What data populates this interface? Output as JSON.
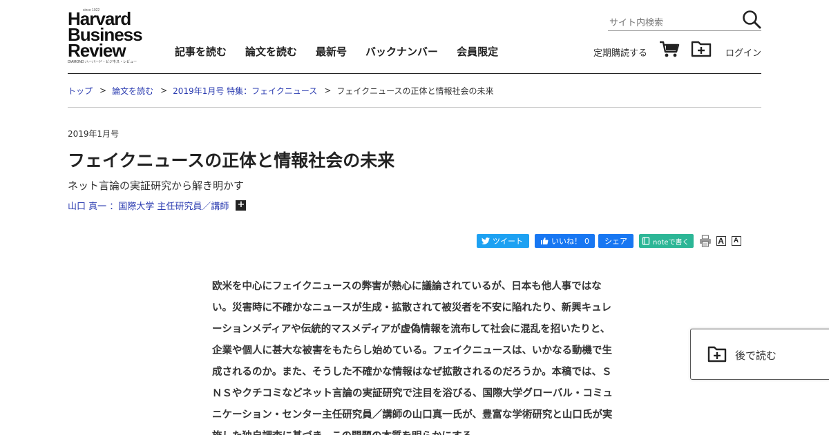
{
  "header": {
    "logo": {
      "tagline": "since 1922",
      "line1": "Harvard",
      "line2": "Business",
      "line3": "Review",
      "sub": "DIAMOND ハーバード・ビジネス・レビュー"
    },
    "nav": [
      {
        "label": "記事を読む"
      },
      {
        "label": "論文を読む"
      },
      {
        "label": "最新号"
      },
      {
        "label": "バックナンバー"
      },
      {
        "label": "会員限定"
      }
    ],
    "search": {
      "placeholder": "サイト内検索",
      "icon": "search-icon"
    },
    "subscribe_label": "定期購読する",
    "cart_icon": "cart-icon",
    "read_later_icon": "folder-plus-icon",
    "login_label": "ログイン"
  },
  "breadcrumb": {
    "items": [
      {
        "label": "トップ"
      },
      {
        "label": "論文を読む"
      },
      {
        "label": "2019年1月号 特集：フェイクニュース"
      }
    ],
    "separator": ">",
    "current": "フェイクニュースの正体と情報社会の未来"
  },
  "article": {
    "issue": "2019年1月号",
    "title": "フェイクニュースの正体と情報社会の未来",
    "subtitle": "ネット言論の実証研究から解き明かす",
    "author": "山口 真一 ：国際大学 主任研究員／講師",
    "author_more": "+",
    "lead": "欧米を中心にフェイクニュースの弊害が熱心に議論されているが、日本も他人事ではない。災害時に不確かなニュースが生成・拡散されて被災者を不安に陥れたり、新興キュレーションメディアや伝統的マスメディアが虚偽情報を流布して社会に混乱を招いたりと、企業や個人に甚大な被害をもたらし始めている。フェイクニュースは、いかなる動機で生成されるのか。また、そうした不確かな情報はなぜ拡散されるのだろうか。本稿では、ＳＮＳやクチコミなどネット言論の実証研究で注目を浴びる、国際大学グローバル・コミュニケーション・センター主任研究員／講師の山口真一氏が、豊富な学術研究と山口氏が実施した独自調査に基づき、この問題の本質を明らかにする。"
  },
  "share": {
    "tweet_label": "ツイート",
    "like_label": "いいね！",
    "like_count": "0",
    "share_label": "シェア",
    "note_label": "noteで書く",
    "print_icon": "print-icon",
    "font_large": "A",
    "font_small": "A",
    "colors": {
      "twitter": "#1da1f2",
      "facebook": "#1877f2",
      "note": "#2cb696"
    }
  },
  "read_later": {
    "label": "後で読む",
    "icon": "folder-plus-icon"
  },
  "colors": {
    "link": "#2a3bb0",
    "text": "#222222"
  }
}
